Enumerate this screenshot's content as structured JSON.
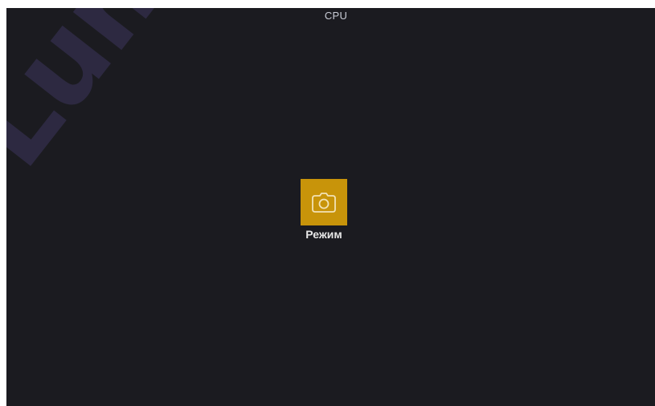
{
  "header": {
    "title": "CPU"
  },
  "watermark": {
    "text": "Lumatek"
  },
  "main": {
    "mode_button": {
      "label": "Режим",
      "icon": "camera-icon",
      "color": "#c8940a"
    }
  },
  "colors": {
    "background": "#1b1b20",
    "watermark": "#2f2b45"
  }
}
